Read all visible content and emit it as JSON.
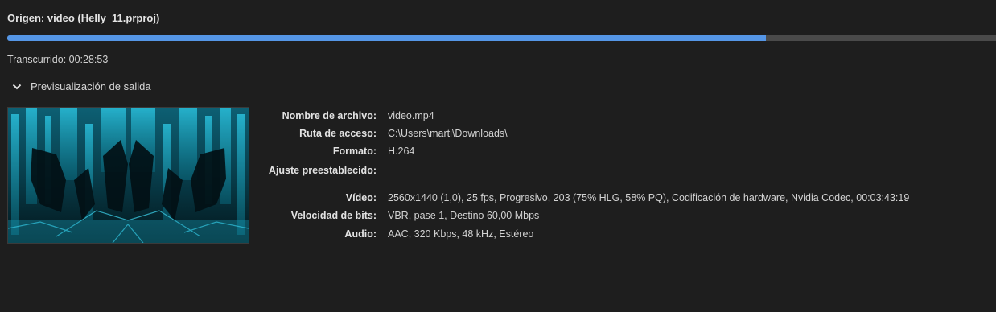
{
  "header": {
    "origin_title": "Origen: video (Helly_11.prproj)"
  },
  "progress": {
    "fraction": 0.767
  },
  "elapsed": "Transcurrido: 00:28:53",
  "preview_section": {
    "label": "Previsualización de salida",
    "expanded": true
  },
  "details": {
    "filename_label": "Nombre de archivo:",
    "filename_value": "video.mp4",
    "path_label": "Ruta de acceso:",
    "path_value": "C:\\Users\\marti\\Downloads\\",
    "format_label": "Formato:",
    "format_value": "H.264",
    "preset_label": "Ajuste preestablecido:",
    "preset_value": "",
    "video_label": "Vídeo:",
    "video_value": "2560x1440 (1,0), 25 fps, Progresivo, 203 (75% HLG, 58% PQ), Codificación de hardware, Nvidia Codec, 00:03:43:19",
    "bitrate_label": "Velocidad de bits:",
    "bitrate_value": "VBR, pase 1, Destino 60,00 Mbps",
    "audio_label": "Audio:",
    "audio_value": "AAC, 320 Kbps, 48 kHz, Estéreo"
  },
  "colors": {
    "background": "#1e1e1e",
    "progress_fill": "#5596e6",
    "progress_track": "#4a4a4a",
    "thumbnail_accent": "#1aa7c4"
  }
}
